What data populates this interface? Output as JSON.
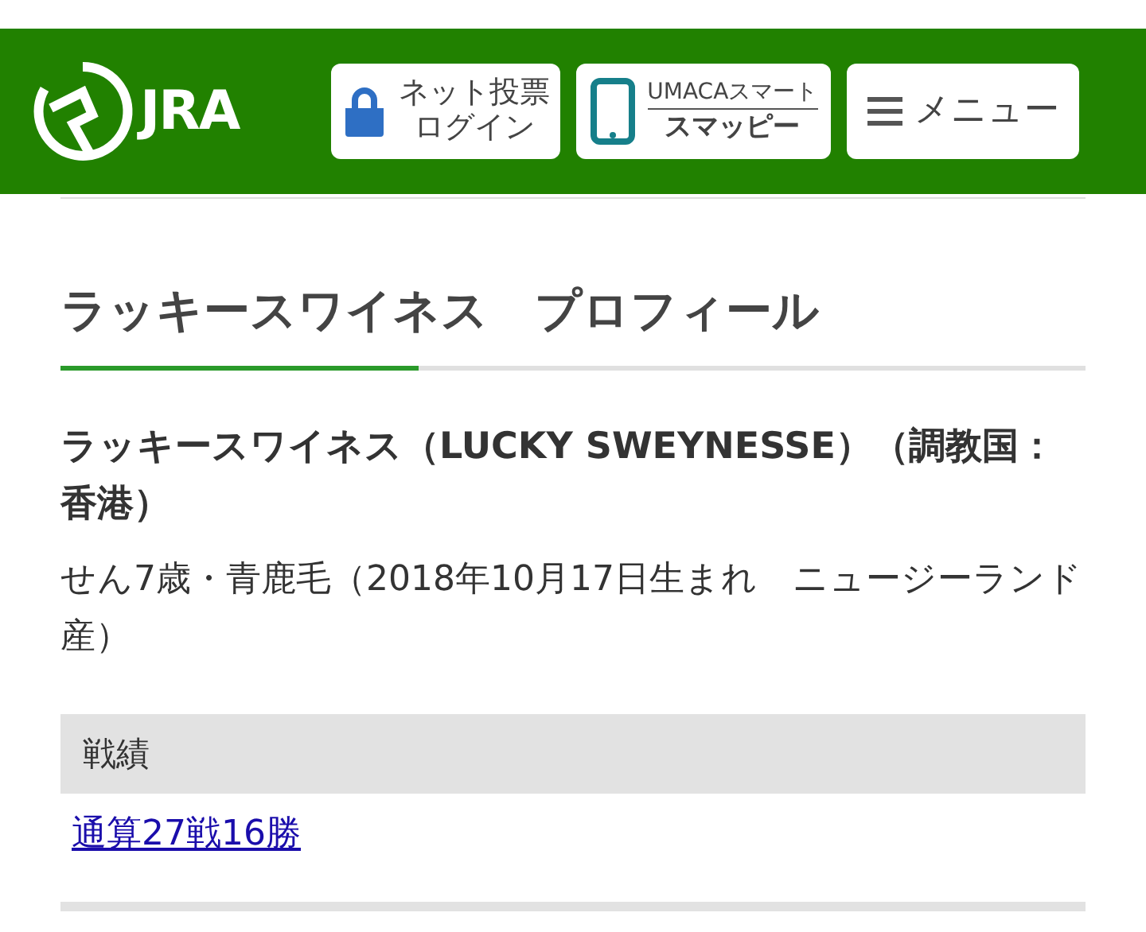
{
  "header": {
    "logo": "JRA",
    "buttons": [
      {
        "kind": "login",
        "lines": [
          "ネット投票",
          "ログイン"
        ]
      },
      {
        "kind": "app",
        "lines": [
          "UMACAスマート",
          "スマッピー"
        ]
      },
      {
        "kind": "menu",
        "lines": [
          "メニュー"
        ]
      }
    ]
  },
  "page_title": "ラッキースワイネス　プロフィール",
  "horse_name": "ラッキースワイネス（LUCKY SWEYNESSE）（調教国：香港）",
  "horse_info": "せん7歳・青鹿毛（2018年10月17日生まれ　ニュージーランド産）",
  "sections": [
    {
      "heading": "戦績",
      "link": "通算27戦16勝"
    }
  ]
}
